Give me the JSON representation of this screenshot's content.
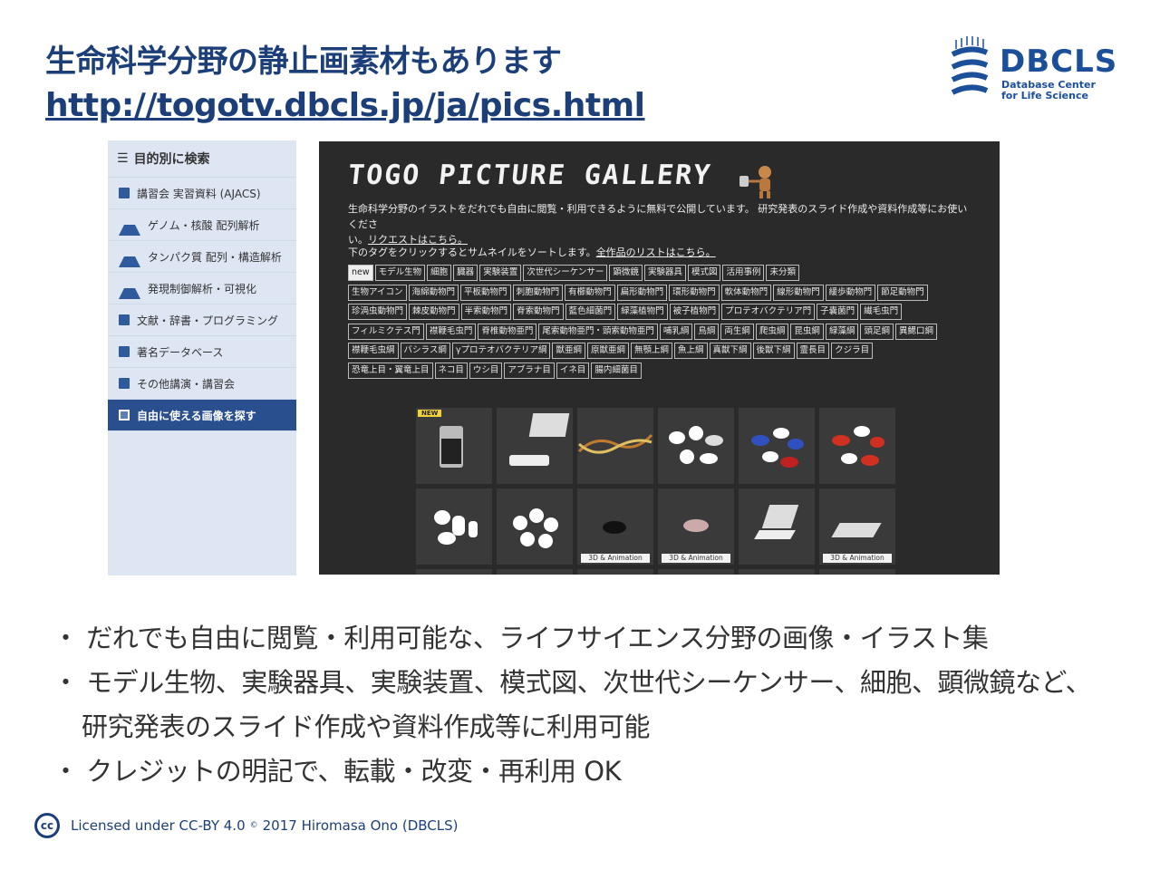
{
  "slide": {
    "title": "生命科学分野の静止画素材もあります",
    "url": "http://togotv.dbcls.jp/ja/pics.html",
    "logo": {
      "name": "DBCLS",
      "line1": "Database Center",
      "line2": "for Life Science"
    }
  },
  "sidebar": {
    "heading": "目的別に検索",
    "items": [
      {
        "label": "講習会 実習資料 (AJACS)",
        "icon": "pencil-icon"
      },
      {
        "label": "ゲノム・核酸 配列解析",
        "icon": "flask-icon"
      },
      {
        "label": "タンパク質 配列・構造解析",
        "icon": "flask-icon"
      },
      {
        "label": "発現制御解析・可視化",
        "icon": "flask-icon"
      },
      {
        "label": "文献・辞書・プログラミング",
        "icon": "book-icon"
      },
      {
        "label": "著名データベース",
        "icon": "book-icon"
      },
      {
        "label": "その他講演・講習会",
        "icon": "book-icon"
      },
      {
        "label": "自由に使える画像を探す",
        "icon": "image-icon",
        "active": true
      }
    ]
  },
  "gallery": {
    "title": "TOGO PICTURE GALLERY",
    "desc_line1": "生命科学分野のイラストをだれでも自由に閲覧・利用できるように無料で公開しています。 研究発表のスライド作成や資料作成等にお使いくださ",
    "desc_line2": "い。",
    "request_link": "リクエストはこちら。",
    "sort_text": "下のタグをクリックするとサムネイルをソートします。",
    "list_link": "全作品のリストはこちら。",
    "tag_rows": [
      [
        "new",
        "モデル生物",
        "細胞",
        "臓器",
        "実験装置",
        "次世代シーケンサー",
        "顕微鏡",
        "実験器具",
        "模式図",
        "活用事例",
        "未分類"
      ],
      [
        "生物アイコン",
        "海綿動物門",
        "平板動物門",
        "刺胞動物門",
        "有櫛動物門",
        "扁形動物門",
        "環形動物門",
        "軟体動物門",
        "線形動物門",
        "緩歩動物門",
        "節足動物門"
      ],
      [
        "珍渦虫動物門",
        "棘皮動物門",
        "半索動物門",
        "脊索動物門",
        "藍色細菌門",
        "緑藻植物門",
        "被子植物門",
        "プロテオバクテリア門",
        "子嚢菌門",
        "繊毛虫門"
      ],
      [
        "フィルミクテス門",
        "襟鞭毛虫門",
        "脊椎動物亜門",
        "尾索動物亜門・頭索動物亜門",
        "哺乳綱",
        "鳥綱",
        "両生綱",
        "爬虫綱",
        "昆虫綱",
        "緑藻綱",
        "頭足綱",
        "異鰓口綱"
      ],
      [
        "襟鞭毛虫綱",
        "バシラス綱",
        "γプロテオバクテリア綱",
        "獣亜綱",
        "原獣亜綱",
        "無顎上綱",
        "魚上綱",
        "真獣下綱",
        "後獣下綱",
        "霊長目",
        "クジラ目"
      ],
      [
        "恐竜上目・翼竜上目",
        "ネコ目",
        "ウシ目",
        "アブラナ目",
        "イネ目",
        "腸内細菌目"
      ]
    ],
    "thumbs": [
      {
        "name": "sequencer-thumb",
        "badge": "NEW"
      },
      {
        "name": "laptop-device-thumb"
      },
      {
        "name": "dna-thumb"
      },
      {
        "name": "capsules-black-thumb"
      },
      {
        "name": "capsules-blue-thumb"
      },
      {
        "name": "capsules-red-thumb"
      },
      {
        "name": "white-pills-thumb"
      },
      {
        "name": "white-tablets-thumb"
      },
      {
        "name": "mouse-black-thumb",
        "strip": "3D & Animation"
      },
      {
        "name": "mouse-white-thumb",
        "strip": "3D & Animation"
      },
      {
        "name": "laptop-thumb"
      },
      {
        "name": "tablet-thumb",
        "strip": "3D & Animation"
      }
    ]
  },
  "bullets": [
    "・ だれでも自由に閲覧・利用可能な、ライフサイエンス分野の画像・イラスト集",
    "・ モデル生物、実験器具、実験装置、模式図、次世代シーケンサー、細胞、顕微鏡など、",
    "研究発表のスライド作成や資料作成等に利用可能",
    "・ クレジットの明記で、転載・改変・再利用  OK"
  ],
  "footer": {
    "cc": "cc",
    "license": "Licensed under CC-BY 4.0",
    "copy_sym": "©",
    "copyright": "2017 Hiromasa Ono (DBCLS)"
  }
}
